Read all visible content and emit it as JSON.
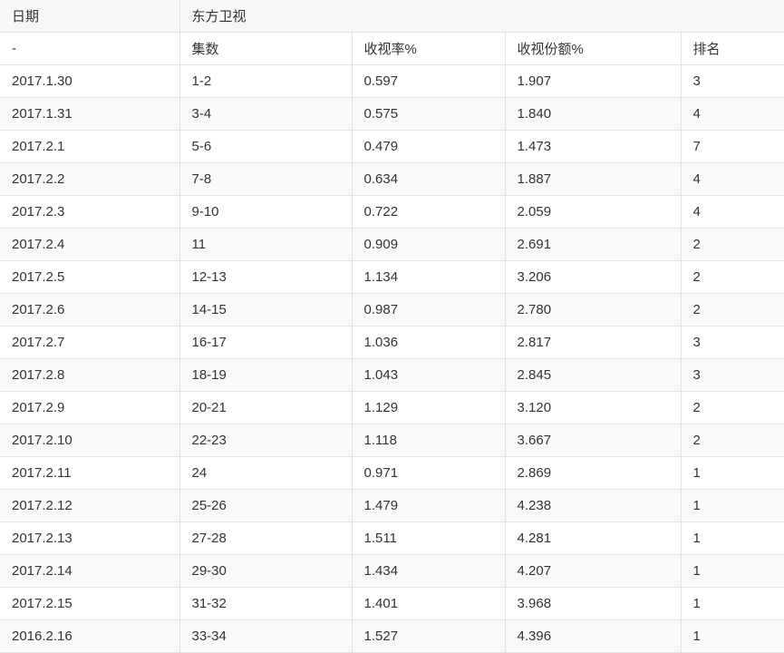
{
  "header": {
    "date_label": "日期",
    "channel_label": "东方卫视"
  },
  "subheader": {
    "date_placeholder": "-",
    "episodes_label": "集数",
    "rating_label": "收视率%",
    "share_label": "收视份额%",
    "rank_label": "排名"
  },
  "rows": [
    {
      "date": "2017.1.30",
      "episodes": "1-2",
      "rating": "0.597",
      "share": "1.907",
      "rank": "3"
    },
    {
      "date": "2017.1.31",
      "episodes": "3-4",
      "rating": "0.575",
      "share": "1.840",
      "rank": "4"
    },
    {
      "date": "2017.2.1",
      "episodes": "5-6",
      "rating": "0.479",
      "share": "1.473",
      "rank": "7"
    },
    {
      "date": "2017.2.2",
      "episodes": "7-8",
      "rating": "0.634",
      "share": "1.887",
      "rank": "4"
    },
    {
      "date": "2017.2.3",
      "episodes": "9-10",
      "rating": "0.722",
      "share": "2.059",
      "rank": "4"
    },
    {
      "date": "2017.2.4",
      "episodes": "11",
      "rating": "0.909",
      "share": "2.691",
      "rank": "2"
    },
    {
      "date": "2017.2.5",
      "episodes": "12-13",
      "rating": "1.134",
      "share": "3.206",
      "rank": "2"
    },
    {
      "date": "2017.2.6",
      "episodes": "14-15",
      "rating": "0.987",
      "share": "2.780",
      "rank": "2"
    },
    {
      "date": "2017.2.7",
      "episodes": "16-17",
      "rating": "1.036",
      "share": "2.817",
      "rank": "3"
    },
    {
      "date": "2017.2.8",
      "episodes": "18-19",
      "rating": "1.043",
      "share": "2.845",
      "rank": "3"
    },
    {
      "date": "2017.2.9",
      "episodes": "20-21",
      "rating": "1.129",
      "share": "3.120",
      "rank": "2"
    },
    {
      "date": "2017.2.10",
      "episodes": "22-23",
      "rating": "1.118",
      "share": "3.667",
      "rank": "2"
    },
    {
      "date": "2017.2.11",
      "episodes": "24",
      "rating": "0.971",
      "share": "2.869",
      "rank": "1"
    },
    {
      "date": "2017.2.12",
      "episodes": "25-26",
      "rating": "1.479",
      "share": "4.238",
      "rank": "1"
    },
    {
      "date": "2017.2.13",
      "episodes": "27-28",
      "rating": "1.511",
      "share": "4.281",
      "rank": "1"
    },
    {
      "date": "2017.2.14",
      "episodes": "29-30",
      "rating": "1.434",
      "share": "4.207",
      "rank": "1"
    },
    {
      "date": "2017.2.15",
      "episodes": "31-32",
      "rating": "1.401",
      "share": "3.968",
      "rank": "1"
    },
    {
      "date": "2016.2.16",
      "episodes": "33-34",
      "rating": "1.527",
      "share": "4.396",
      "rank": "1"
    }
  ]
}
